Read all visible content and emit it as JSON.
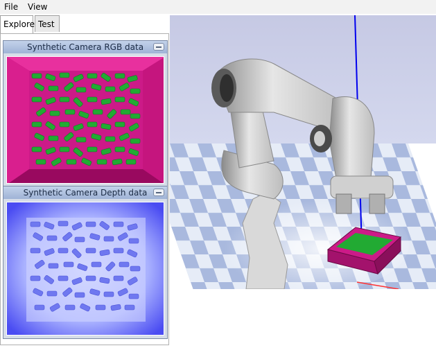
{
  "menubar": {
    "file_label": "File",
    "view_label": "View"
  },
  "tabs": [
    {
      "label": "Explorer"
    },
    {
      "label": "Test"
    }
  ],
  "rgb_window": {
    "title": "Synthetic Camera RGB data"
  },
  "depth_window": {
    "title": "Synthetic Camera Depth data"
  },
  "colors": {
    "sky": "#c9cde6",
    "floor_light": "#e8eef8",
    "floor_dark": "#9fb0d8",
    "bin_magenta": "#cc1a88",
    "objects_green": "#22aa33",
    "depth_blue": "#5a5aff",
    "axis_blue": "#0000ee"
  }
}
